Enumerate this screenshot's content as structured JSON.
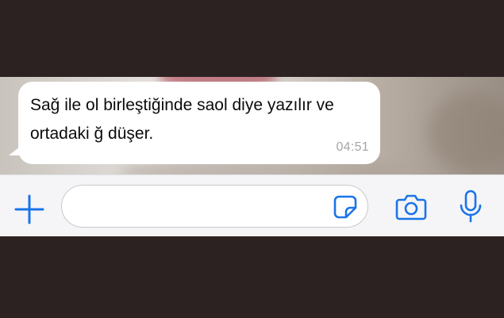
{
  "message": {
    "text": "Sağ ile ol birleştiğinde saol diye yazılır ve ortadaki ğ düşer.",
    "time": "04:51"
  },
  "input_bar": {
    "message_value": "",
    "icons": {
      "add": "plus-icon",
      "sticker": "sticker-icon",
      "camera": "camera-icon",
      "microphone": "microphone-icon"
    }
  },
  "colors": {
    "accent": "#1a74e8",
    "bubble": "#ffffff",
    "timestamp": "#a5a5a5",
    "frame": "#2d2222"
  }
}
